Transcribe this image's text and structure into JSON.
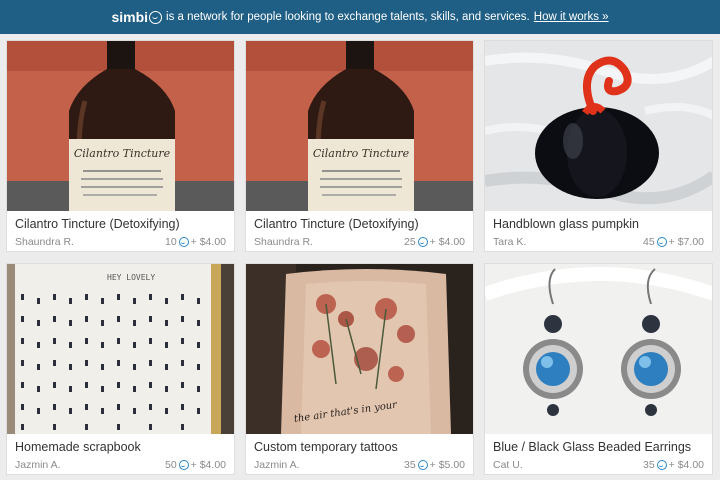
{
  "banner": {
    "brand": "simbi",
    "tagline": "is a network for people looking to exchange talents, skills, and services.",
    "link": "How it works »"
  },
  "listings": [
    {
      "title": "Cilantro Tincture (Detoxifying)",
      "owner": "Shaundra R.",
      "simbi": "10",
      "cash": "+ $4.00"
    },
    {
      "title": "Cilantro Tincture (Detoxifying)",
      "owner": "Shaundra R.",
      "simbi": "25",
      "cash": "+ $4.00"
    },
    {
      "title": "Handblown glass pumpkin",
      "owner": "Tara K.",
      "simbi": "45",
      "cash": "+ $7.00"
    },
    {
      "title": "Homemade scrapbook",
      "owner": "Jazmin A.",
      "simbi": "50",
      "cash": "+ $4.00"
    },
    {
      "title": "Custom temporary tattoos",
      "owner": "Jazmin A.",
      "simbi": "35",
      "cash": "+ $5.00"
    },
    {
      "title": "Blue / Black Glass Beaded Earrings",
      "owner": "Cat U.",
      "simbi": "35",
      "cash": "+ $4.00"
    }
  ],
  "image_text": {
    "tincture_label": "Cilantro Tincture",
    "scrapbook_text": "HEY LOVELY",
    "tattoo_text": "the air that's in your"
  }
}
